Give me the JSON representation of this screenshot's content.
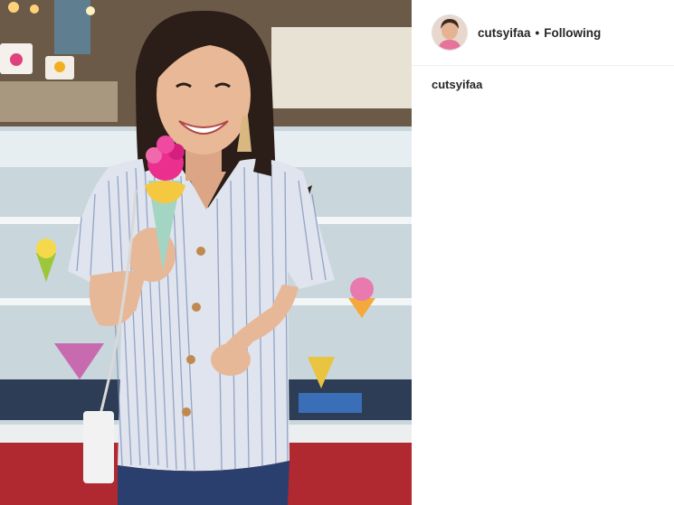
{
  "post": {
    "username": "cutsyifaa",
    "separator": "•",
    "follow_status": "Following",
    "caption_username": "cutsyifaa"
  },
  "photo": {
    "subject": "woman in striped shirt holding pink and green ice cream cone in front of gelato display case"
  },
  "colors": {
    "text": "#262626",
    "divider": "#efefef",
    "background": "#ffffff"
  }
}
